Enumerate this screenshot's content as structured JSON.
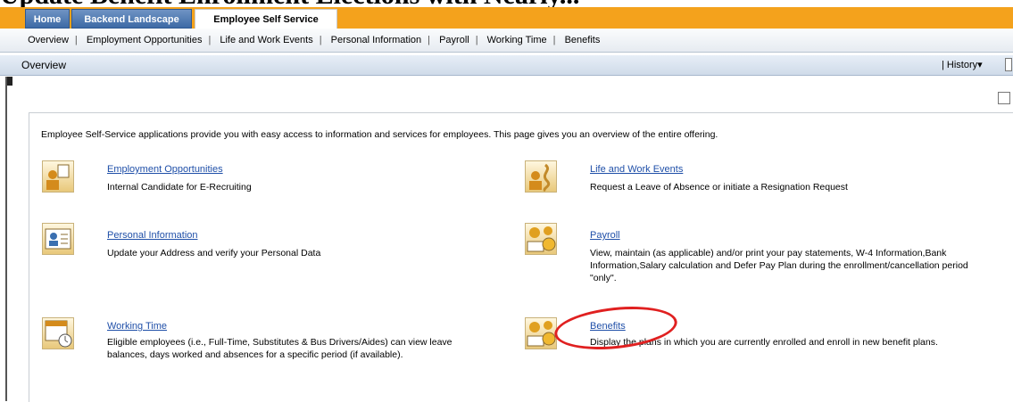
{
  "caption_cropped": "Update Benefit Enrollment Elections with Nearly...",
  "top_nav": {
    "tabs": [
      {
        "label": "Home"
      },
      {
        "label": "Backend Landscape"
      },
      {
        "label": "Employee Self Service"
      }
    ]
  },
  "sub_nav": {
    "items": [
      "Overview",
      "Employment Opportunities",
      "Life and Work Events",
      "Personal Information",
      "Payroll",
      "Working Time",
      "Benefits"
    ]
  },
  "page": {
    "title": "Overview",
    "history_label": "History"
  },
  "intro_text": "Employee Self-Service applications provide you with easy access to information and services for employees. This page gives you an overview of the entire offering.",
  "tiles": [
    {
      "title": "Employment Opportunities",
      "desc": "Internal Candidate for E-Recruiting",
      "icon": "employment-icon"
    },
    {
      "title": "Life and Work Events",
      "desc": "Request a Leave of Absence or initiate a Resignation Request",
      "icon": "life-events-icon"
    },
    {
      "title": "Personal Information",
      "desc": "Update your Address and verify your Personal Data",
      "icon": "personal-info-icon"
    },
    {
      "title": "Payroll",
      "desc": "View, maintain (as applicable) and/or print your pay statements, W-4 Information,Bank Information,Salary calculation and Defer Pay Plan during the enrollment/cancellation period \"only\".",
      "icon": "payroll-icon"
    },
    {
      "title": "Working Time",
      "desc": "Eligible employees (i.e., Full-Time, Substitutes & Bus Drivers/Aides) can view leave balances, days worked and absences for a specific period (if available).",
      "icon": "calendar-clock-icon"
    },
    {
      "title": "Benefits",
      "desc": "Display the plans in which you are currently enrolled and enroll in new benefit plans.",
      "icon": "benefits-icon"
    }
  ],
  "colors": {
    "accent": "#f4a21c",
    "link": "#1f4fa8",
    "highlight": "#e02020"
  }
}
